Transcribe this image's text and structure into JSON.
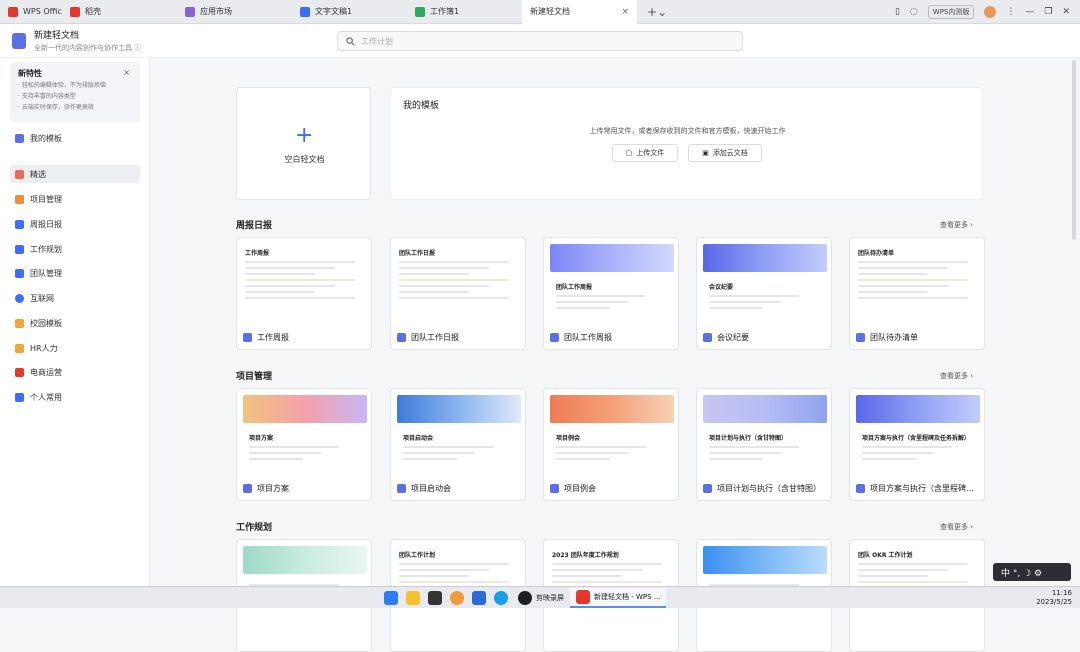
{
  "tabs": [
    {
      "label": "WPS Office",
      "color": "#e5382d"
    },
    {
      "label": "稻壳",
      "color": "#e5382d"
    },
    {
      "label": "应用市场",
      "color": "#8a63d2"
    },
    {
      "label": "文字文稿1",
      "color": "#3d6dff"
    },
    {
      "label": "工作簿1",
      "color": "#2fa861"
    },
    {
      "label": "新建轻文档",
      "color": ""
    }
  ],
  "tab_close": "×",
  "tab_add": "+",
  "tab_add_chevron": "⌄",
  "window": {
    "beta_label": "WPS内测版",
    "minimize": "—",
    "maximize": "❐",
    "close": "✕"
  },
  "header": {
    "title": "新建轻文档",
    "subtitle": "全新一代的内容创作与协作工具 ⓘ",
    "search_placeholder": "工作计划"
  },
  "new_features": {
    "title": "新特性",
    "close": "×",
    "lines": [
      "· 轻松的编辑体验，不为排版烦恼",
      "· 支持丰富的内容类型",
      "· 云端实时保存，协作更高效"
    ]
  },
  "sidebar": {
    "items": [
      {
        "label": "我的模板",
        "color": "#5b6fe6"
      },
      {
        "label": "精选",
        "color": "#e86a5a"
      },
      {
        "label": "项目管理",
        "color": "#f08a3c"
      },
      {
        "label": "周报日报",
        "color": "#3d6dff"
      },
      {
        "label": "工作规划",
        "color": "#3d6dff"
      },
      {
        "label": "团队管理",
        "color": "#3d6dff"
      },
      {
        "label": "互联网",
        "color": "#3d6dff"
      },
      {
        "label": "校园模板",
        "color": "#f2a33a"
      },
      {
        "label": "HR人力",
        "color": "#f2a33a"
      },
      {
        "label": "电商运营",
        "color": "#e5382d"
      },
      {
        "label": "个人常用",
        "color": "#3d6dff"
      }
    ]
  },
  "blank_doc": {
    "plus": "+",
    "label": "空白轻文档"
  },
  "my_templates": {
    "title": "我的模板",
    "description": "上传常用文件，或者保存收到的文件和官方模板，快速开始工作",
    "upload_label": "上传文件",
    "add_cloud_label": "添加云文档"
  },
  "sections": [
    {
      "title": "周报日报",
      "more": "查看更多 ›",
      "cards": [
        {
          "name": "工作周报",
          "preview_title": "工作周报",
          "banner": ""
        },
        {
          "name": "团队工作日报",
          "preview_title": "团队工作日报",
          "banner": ""
        },
        {
          "name": "团队工作周报",
          "preview_title": "团队工作周报",
          "banner": "b-purple"
        },
        {
          "name": "会议纪要",
          "preview_title": "会议纪要",
          "banner": "b-violet"
        },
        {
          "name": "团队待办清单",
          "preview_title": "团队待办清单",
          "banner": ""
        }
      ]
    },
    {
      "title": "项目管理",
      "more": "查看更多 ›",
      "cards": [
        {
          "name": "项目方案",
          "preview_title": "项目方案",
          "banner": "b-sunset"
        },
        {
          "name": "项目启动会",
          "preview_title": "项目启动会",
          "banner": "b-blue"
        },
        {
          "name": "项目例会",
          "preview_title": "项目例会",
          "banner": "b-orange"
        },
        {
          "name": "项目计划与执行（含甘特图）",
          "preview_title": "项目计划与执行（含甘特图）",
          "banner": "b-lav"
        },
        {
          "name": "项目方案与执行（含里程碑…",
          "preview_title": "项目方案与执行（含里程碑及任务拆解）",
          "banner": "b-violet"
        }
      ]
    },
    {
      "title": "工作规划",
      "more": "查看更多 ›",
      "cards": [
        {
          "name": "",
          "preview_title": "",
          "banner": "b-green"
        },
        {
          "name": "",
          "preview_title": "团队工作计划",
          "banner": ""
        },
        {
          "name": "",
          "preview_title": "2023 团队年度工作规划",
          "banner": ""
        },
        {
          "name": "",
          "preview_title": "",
          "banner": "b-sky"
        },
        {
          "name": "",
          "preview_title": "团队 OKR 工作计划",
          "banner": ""
        }
      ]
    }
  ],
  "ime": {
    "label": "中 °,  ☽ ⚙"
  },
  "taskbar": {
    "apps": [
      {
        "name": "剪映录屏",
        "color": "#1d1f24"
      },
      {
        "name": "新建轻文档 - WPS ...",
        "color": "#e5382d"
      }
    ],
    "time": "11:16",
    "date": "2023/5/25"
  }
}
